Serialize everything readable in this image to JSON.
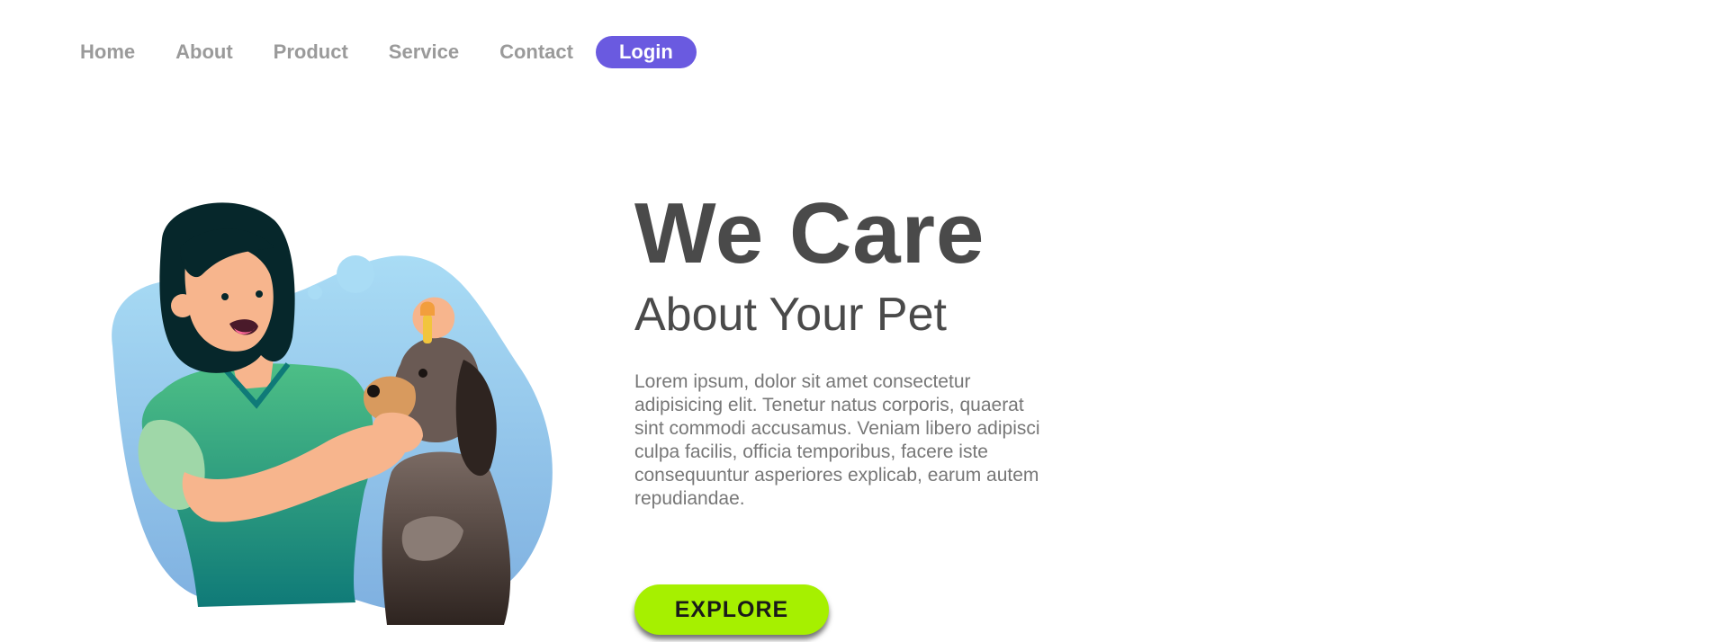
{
  "nav": {
    "items": [
      {
        "label": "Home"
      },
      {
        "label": "About"
      },
      {
        "label": "Product"
      },
      {
        "label": "Service"
      },
      {
        "label": "Contact"
      }
    ],
    "login_label": "Login"
  },
  "hero": {
    "title": "We Care",
    "subtitle": "About Your Pet",
    "body": "Lorem ipsum, dolor sit amet consectetur adipisicing elit. Tenetur natus corporis, quaerat sint commodi accusamus. Veniam libero adipisci culpa facilis, officia temporibus, facere iste consequuntur asperiores explicab, earum autem repudiandae.",
    "cta_label": "EXPLORE"
  },
  "colors": {
    "accent": "#6a5ae0",
    "cta": "#a6f000",
    "heading": "#4a4a4a",
    "nav_text": "#9a9a9a"
  },
  "illustration": {
    "icon": "woman-with-dog-illustration"
  }
}
